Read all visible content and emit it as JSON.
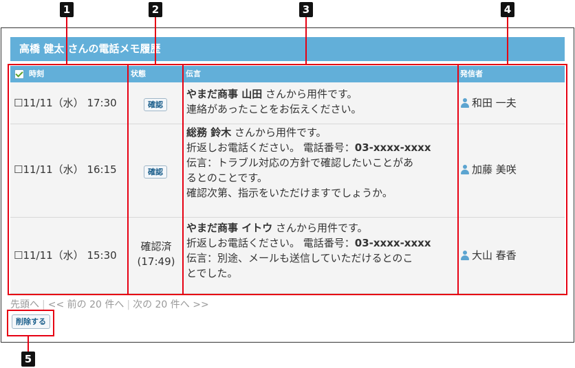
{
  "markers": [
    "1",
    "2",
    "3",
    "4",
    "5"
  ],
  "title": "高橋 健太 さんの電話メモ履歴",
  "columns": {
    "time": "時刻",
    "status": "状態",
    "message": "伝言",
    "sender": "発信者"
  },
  "rows": [
    {
      "time": "☐11/11（水） 17:30",
      "status_button": "確認",
      "msg_from_bold": "やまだ商事 山田",
      "msg_from_rest": " さんから用件です。",
      "lines": [
        "連絡があったことをお伝えください。"
      ],
      "sender": "和田 一夫"
    },
    {
      "time": "☐11/11（水） 16:15",
      "status_button": "確認",
      "msg_from_bold": "総務 鈴木",
      "msg_from_rest": " さんから用件です。",
      "phone_prefix": "折返しお電話ください。 電話番号：",
      "phone": "03-xxxx-xxxx",
      "lines": [
        "伝言：トラブル対応の方針で確認したいことがあ",
        "るとのことです。",
        "確認次第、指示をいただけますでしょうか。"
      ],
      "sender": "加藤 美咲"
    },
    {
      "time": "☐11/11（水） 15:30",
      "status_text": "確認済",
      "status_time": "(17:49)",
      "msg_from_bold": "やまだ商事 イトウ",
      "msg_from_rest": " さんから用件です。",
      "phone_prefix": "折返しお電話ください。 電話番号：",
      "phone": "03-xxxx-xxxx",
      "lines": [
        "伝言：別途、メールも送信していただけるとのこ",
        "とでした。"
      ],
      "sender": "大山 春香"
    }
  ],
  "pager": {
    "first": "先頭へ",
    "prev": "<< 前の 20 件へ",
    "next": "次の 20 件へ >>"
  },
  "delete_button": "削除する",
  "colors": {
    "header": "#62afd9",
    "highlight": "#e60012"
  }
}
